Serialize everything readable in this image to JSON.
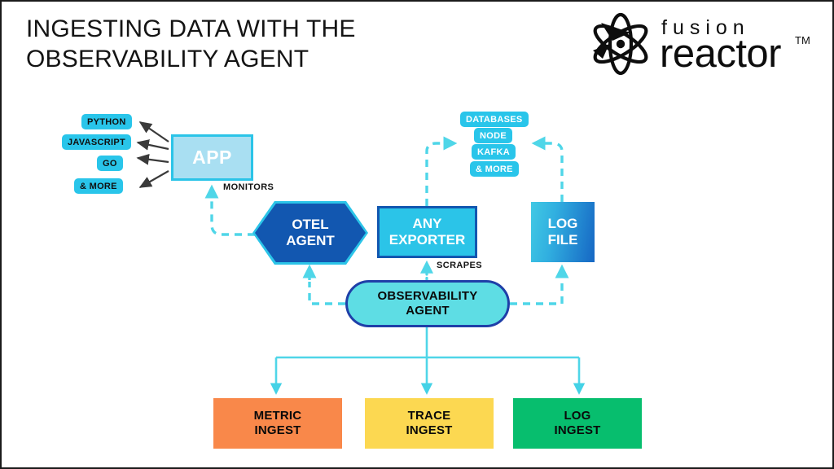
{
  "slide": {
    "title_lines": [
      "INGESTING DATA WITH THE",
      "OBSERVABILITY AGENT"
    ],
    "logo": {
      "icon": "atom-icon",
      "word_top": "fusion",
      "word_bottom": "reactor",
      "trademark": "TM"
    }
  },
  "left_languages": [
    {
      "label": "PYTHON"
    },
    {
      "label": "JAVASCRIPT"
    },
    {
      "label": "GO"
    },
    {
      "label": "& MORE"
    }
  ],
  "right_sources": [
    {
      "label": "DATABASES"
    },
    {
      "label": "NODE"
    },
    {
      "label": "KAFKA"
    },
    {
      "label": "& MORE"
    }
  ],
  "nodes": {
    "app": {
      "label": "APP"
    },
    "otel_agent": {
      "line1": "OTEL",
      "line2": "AGENT"
    },
    "any_exporter": {
      "line1": "ANY",
      "line2": "EXPORTER"
    },
    "log_file": {
      "line1": "LOG",
      "line2": "FILE"
    },
    "observability_agent": {
      "line1": "OBSERVABILITY",
      "line2": "AGENT"
    }
  },
  "annotations": {
    "monitors": "MONITORS",
    "scrapes": "SCRAPES"
  },
  "ingest": [
    {
      "line1": "METRIC",
      "line2": "INGEST",
      "color": "#F9884A"
    },
    {
      "line1": "TRACE",
      "line2": "INGEST",
      "color": "#FCD851"
    },
    {
      "line1": "LOG",
      "line2": "INGEST",
      "color": "#07BE6E"
    }
  ],
  "colors": {
    "cyan": "#2BC4E8",
    "pill_cyan": "#29C5EA",
    "dark_blue": "#1257B0",
    "navy_border": "#1F3FA8",
    "turquoise": "#5EDDE4",
    "app_fill": "#A9DFF2",
    "arrow_gray": "#3A3A3A",
    "orange": "#F9884A",
    "yellow": "#FCD851",
    "green": "#07BE6E",
    "frame": "#1a1a1a"
  }
}
